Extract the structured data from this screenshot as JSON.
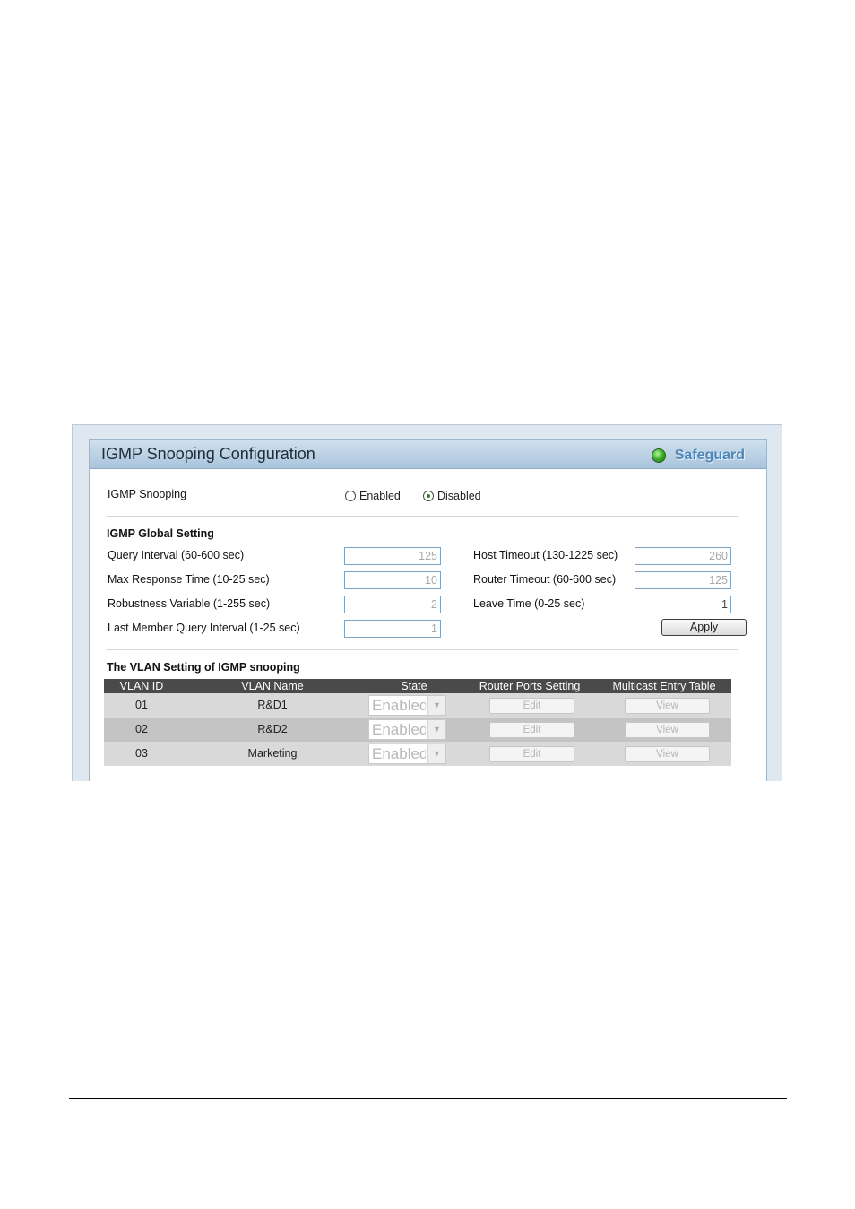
{
  "panel": {
    "title": "IGMP Snooping Configuration",
    "safeguard": "Safeguard"
  },
  "igmp_snooping": {
    "label": "IGMP Snooping",
    "options": [
      {
        "label": "Enabled",
        "checked": false
      },
      {
        "label": "Disabled",
        "checked": true
      }
    ]
  },
  "global": {
    "heading": "IGMP Global Setting",
    "left": [
      {
        "label": "Query Interval (60-600 sec)",
        "value": "125"
      },
      {
        "label": "Max Response Time (10-25 sec)",
        "value": "10"
      },
      {
        "label": "Robustness Variable (1-255 sec)",
        "value": "2"
      },
      {
        "label": "Last Member Query Interval (1-25 sec)",
        "value": "1"
      }
    ],
    "right": [
      {
        "label": "Host Timeout (130-1225 sec)",
        "value": "260"
      },
      {
        "label": "Router Timeout (60-600 sec)",
        "value": "125"
      },
      {
        "label": "Leave Time (0-25 sec)",
        "value": "1"
      }
    ],
    "apply_label": "Apply"
  },
  "vlan": {
    "heading": "The VLAN Setting of IGMP snooping",
    "columns": [
      "VLAN ID",
      "VLAN Name",
      "State",
      "Router Ports Setting",
      "Multicast Entry Table"
    ],
    "rows": [
      {
        "id": "01",
        "name": "R&D1",
        "state": "Enabled",
        "edit": "Edit",
        "view": "View"
      },
      {
        "id": "02",
        "name": "R&D2",
        "state": "Enabled",
        "edit": "Edit",
        "view": "View"
      },
      {
        "id": "03",
        "name": "Marketing",
        "state": "Enabled",
        "edit": "Edit",
        "view": "View"
      }
    ]
  }
}
